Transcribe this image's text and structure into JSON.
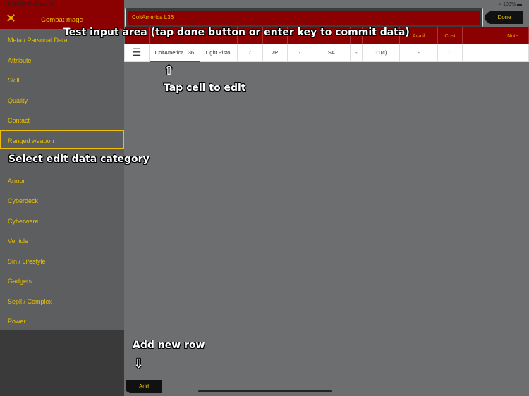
{
  "status": {
    "time": "4:36 PM  Wed Nov 27",
    "battery": "100%"
  },
  "sidebar": {
    "title": "Combat mage",
    "close_icon": "close-icon",
    "items": [
      {
        "label": "Meta / Parsonal Data"
      },
      {
        "label": "Attribute"
      },
      {
        "label": "Skill"
      },
      {
        "label": "Quality"
      },
      {
        "label": "Contact"
      },
      {
        "label": "Ranged weapon",
        "selected": true
      },
      {
        "label": ""
      },
      {
        "label": "Armor"
      },
      {
        "label": "Cyberdeck"
      },
      {
        "label": "Cyberware"
      },
      {
        "label": "Vehicle"
      },
      {
        "label": "Sin / Lifestyle"
      },
      {
        "label": "Gadgets"
      },
      {
        "label": "Sepll / Complex"
      },
      {
        "label": "Power"
      }
    ]
  },
  "input": {
    "value": "ColtAmerica L36",
    "done_label": "Done"
  },
  "table": {
    "headers": [
      "",
      "",
      "",
      "",
      "",
      "",
      "",
      "",
      "",
      "Avalil",
      "Cost",
      "Note"
    ],
    "row": [
      "ColtAmerica L36",
      "Light Pistol",
      "7",
      "7P",
      "-",
      "SA",
      "-",
      "11(c)",
      "-",
      "0",
      ""
    ]
  },
  "annotations": {
    "input": "Test input area (tap done button or enter key to commit data)",
    "cell": "Tap cell to edit",
    "category": "Select edit data category",
    "add": "Add new row"
  },
  "add_label": "Add",
  "colors": {
    "header": "#8b0000",
    "accent": "#f0c000"
  }
}
